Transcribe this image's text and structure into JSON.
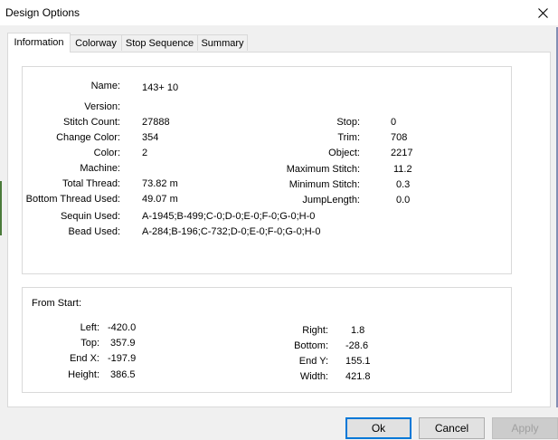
{
  "window": {
    "title": "Design Options"
  },
  "tabs": [
    {
      "label": "Information",
      "active": true
    },
    {
      "label": "Colorway",
      "active": false
    },
    {
      "label": "Stop Sequence",
      "active": false
    },
    {
      "label": "Summary",
      "active": false
    }
  ],
  "info": {
    "name_label": "Name:",
    "name_value": "143+ 10",
    "version_label": "Version:",
    "version_value": "",
    "stitch_count_label": "Stitch Count:",
    "stitch_count_value": "27888",
    "change_color_label": "Change Color:",
    "change_color_value": "354",
    "color_label": "Color:",
    "color_value": "2",
    "machine_label": "Machine:",
    "machine_value": "",
    "total_thread_label": "Total Thread:",
    "total_thread_value": "73.82 m",
    "bottom_thread_label": "Bottom Thread Used:",
    "bottom_thread_value": "49.07 m",
    "sequin_label": "Sequin Used:",
    "sequin_value": "A-1945;B-499;C-0;D-0;E-0;F-0;G-0;H-0",
    "bead_label": "Bead Used:",
    "bead_value": "A-284;B-196;C-732;D-0;E-0;F-0;G-0;H-0",
    "stop_label": "Stop:",
    "stop_value": "0",
    "trim_label": "Trim:",
    "trim_value": "708",
    "object_label": "Object:",
    "object_value": "2217",
    "max_stitch_label": "Maximum Stitch:",
    "max_stitch_value": "11.2",
    "min_stitch_label": "Minimum Stitch:",
    "min_stitch_value": "0.3",
    "jump_length_label": "JumpLength:",
    "jump_length_value": "0.0"
  },
  "from_start": {
    "heading": "From Start:",
    "left_label": "Left:",
    "left_value": "-420.0",
    "top_label": "Top:",
    "top_value": "357.9",
    "end_x_label": "End X:",
    "end_x_value": "-197.9",
    "height_label": "Height:",
    "height_value": "386.5",
    "right_label": "Right:",
    "right_value": "1.8",
    "bottom_label": "Bottom:",
    "bottom_value": "-28.6",
    "end_y_label": "End Y:",
    "end_y_value": "155.1",
    "width_label": "Width:",
    "width_value": "421.8"
  },
  "buttons": {
    "ok": "Ok",
    "cancel": "Cancel",
    "apply": "Apply"
  }
}
